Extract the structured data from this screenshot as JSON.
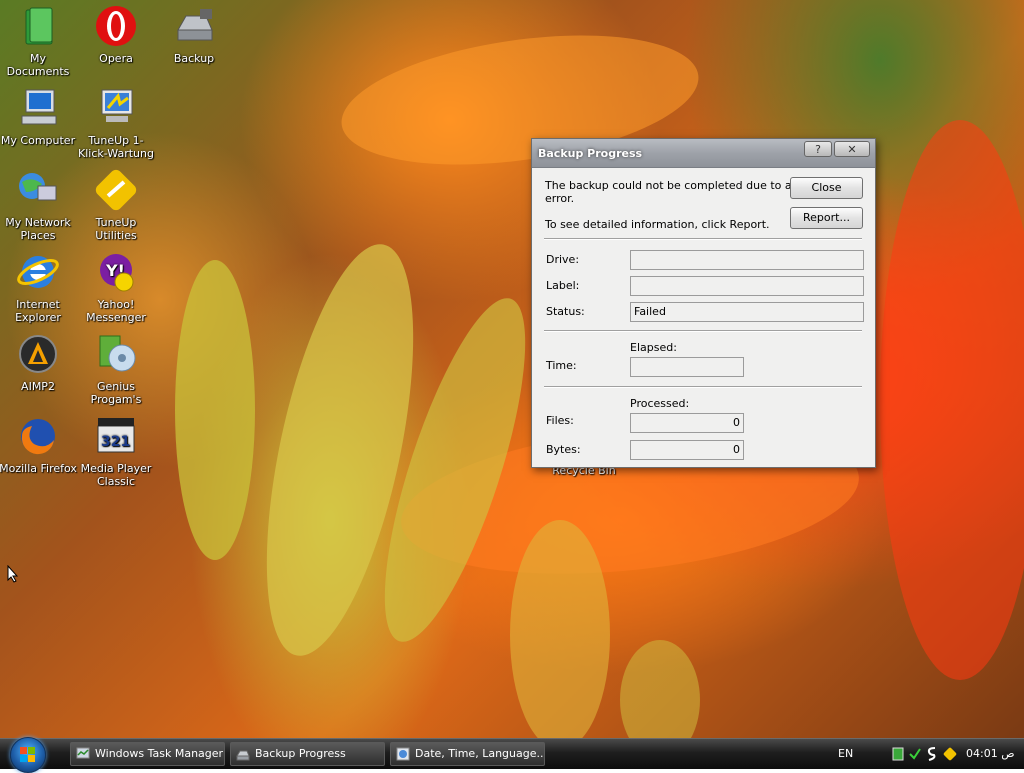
{
  "desktop": {
    "icons": [
      {
        "label": "My Documents",
        "icon": "folder-icon"
      },
      {
        "label": "Opera",
        "icon": "opera-icon"
      },
      {
        "label": "Backup",
        "icon": "drive-icon"
      },
      {
        "label": "My Computer",
        "icon": "computer-icon"
      },
      {
        "label": "TuneUp 1-Klick-Wartung",
        "icon": "tuneup-oneclick-icon"
      },
      {
        "label": "My Network Places",
        "icon": "network-icon"
      },
      {
        "label": "TuneUp Utilities",
        "icon": "tuneup-utilities-icon"
      },
      {
        "label": "Internet Explorer",
        "icon": "ie-icon"
      },
      {
        "label": "Yahoo! Messenger",
        "icon": "yahoo-messenger-icon"
      },
      {
        "label": "AIMP2",
        "icon": "aimp-icon"
      },
      {
        "label": "Genius Progam's",
        "icon": "genius-icon"
      },
      {
        "label": "Mozilla Firefox",
        "icon": "firefox-icon"
      },
      {
        "label": "Media Player Classic",
        "icon": "media-player-icon"
      },
      {
        "label": "Recycle Bin",
        "icon": "recycle-bin-icon"
      }
    ]
  },
  "dialog": {
    "title": "Backup Progress",
    "help_symbol": "?",
    "close_symbol": "✕",
    "message_line1": "The backup could not be completed due to an",
    "message_line2": "error.",
    "message_report": "To see detailed information, click Report.",
    "close_button": "Close",
    "report_button": "Report...",
    "drive_label": "Drive:",
    "drive_value": "",
    "label_label": "Label:",
    "label_value": "",
    "status_label": "Status:",
    "status_value": "Failed",
    "elapsed_label": "Elapsed:",
    "time_label": "Time:",
    "time_value": "",
    "processed_label": "Processed:",
    "files_label": "Files:",
    "files_value": "0",
    "bytes_label": "Bytes:",
    "bytes_value": "0"
  },
  "taskbar": {
    "tasks": [
      {
        "label": "Windows Task Manager",
        "icon": "task-manager-icon"
      },
      {
        "label": "Backup Progress",
        "icon": "backup-icon"
      },
      {
        "label": "Date, Time, Language...",
        "icon": "control-panel-icon"
      }
    ],
    "language": "EN",
    "clock": "04:01 ص"
  },
  "colors": {
    "accent": "#1e5ea8",
    "dialog_bg": "#f0f0ef",
    "titlebar": "#9ea2a9"
  }
}
